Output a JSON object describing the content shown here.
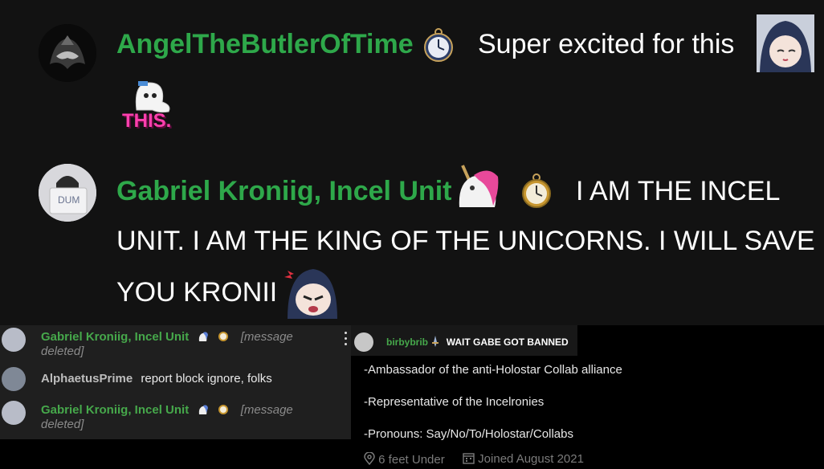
{
  "top_chat": {
    "msg1": {
      "username": "AngelTheButlerOfTime",
      "text": "Super excited for this",
      "emote_text": "THIS."
    },
    "msg2": {
      "username": "Gabriel Kroniig, Incel Unit",
      "avatar_text": "DUM",
      "text_line1": "I AM THE INCEL",
      "text_line2": "UNIT. I AM THE KING OF THE UNICORNS. I WILL SAVE",
      "text_line3": "YOU KRONII"
    }
  },
  "small_chat": {
    "rows": [
      {
        "username": "Gabriel Kroniig, Incel Unit",
        "deleted_1": "[message",
        "deleted_2": "deleted]"
      },
      {
        "username": "AlphaetusPrime",
        "text": "report block ignore, folks"
      },
      {
        "username": "Gabriel Kroniig, Incel Unit",
        "deleted_1": "[message",
        "deleted_2": "deleted]"
      }
    ]
  },
  "profile": {
    "chat_username": "birbybrib",
    "chat_text": "WAIT GABE GOT BANNED",
    "bio": [
      "-Ambassador of the anti-Holostar Collab alliance",
      "-Representative of the Incelronies",
      "-Pronouns: Say/No/To/Holostar/Collabs"
    ],
    "location": "6 feet Under",
    "joined": "Joined August 2021"
  },
  "colors": {
    "username_green": "#2ea84a",
    "bg": "#121212",
    "muted": "#7b7b7b"
  }
}
